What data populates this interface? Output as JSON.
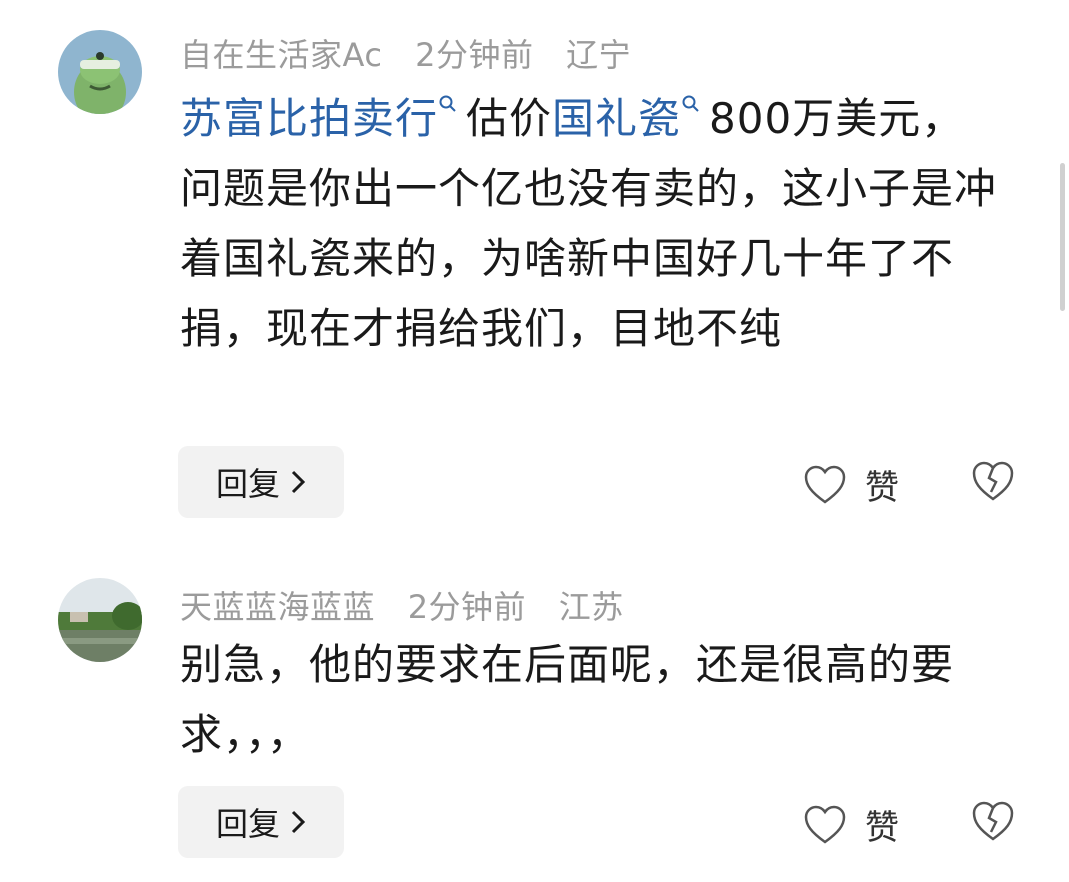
{
  "comments": [
    {
      "username": "自在生活家Ac",
      "time": "2分钟前",
      "location": "辽宁",
      "avatar_icon": "green-creature-avatar-icon",
      "text_parts": [
        {
          "text": "苏富比拍卖行",
          "link": true
        },
        {
          "text": "估价",
          "link": false
        },
        {
          "text": "国礼瓷",
          "link": true
        },
        {
          "text": "800万美元，问题是你出一个亿也没有卖的，这小子是冲着国礼瓷来的，为啥新中国好几十年了不捐，现在才捐给我们，目地不纯",
          "link": false
        }
      ],
      "reply_label": "回复",
      "like_label": "赞"
    },
    {
      "username": "天蓝蓝海蓝蓝",
      "time": "2分钟前",
      "location": "江苏",
      "avatar_icon": "landscape-photo-avatar-icon",
      "text": "别急，他的要求在后面呢，还是很高的要求，，，",
      "reply_label": "回复",
      "like_label": "赞"
    }
  ],
  "colors": {
    "link": "#2a62a8",
    "meta": "#9b9b9b",
    "text": "#1a1a1a",
    "button_bg": "#f2f2f2"
  }
}
